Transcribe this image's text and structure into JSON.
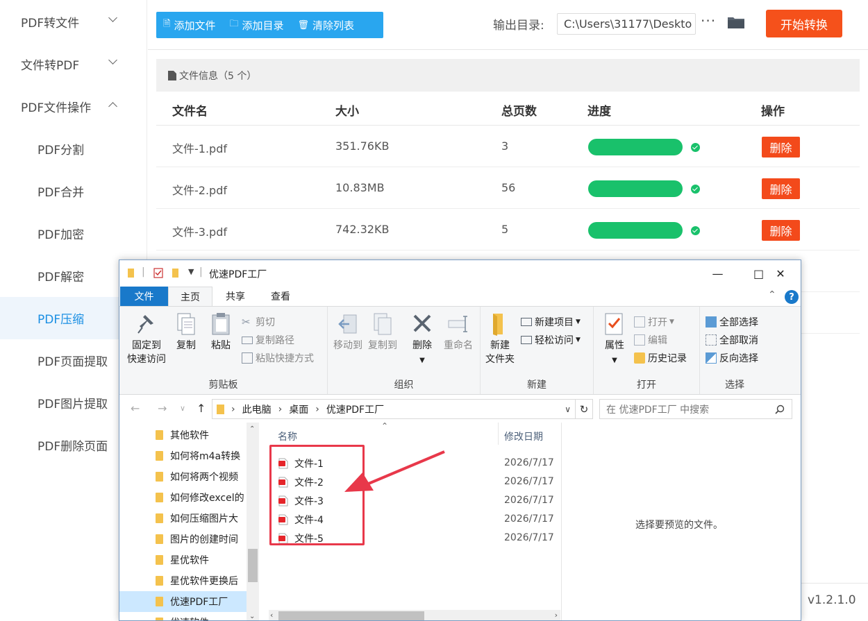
{
  "sidebar": {
    "items": [
      {
        "label": "PDF转文件",
        "chevron": "down"
      },
      {
        "label": "文件转PDF",
        "chevron": "down"
      },
      {
        "label": "PDF文件操作",
        "chevron": "up"
      },
      {
        "label": "PDF分割"
      },
      {
        "label": "PDF合并"
      },
      {
        "label": "PDF加密"
      },
      {
        "label": "PDF解密"
      },
      {
        "label": "PDF压缩",
        "active": true
      },
      {
        "label": "PDF页面提取"
      },
      {
        "label": "PDF图片提取"
      },
      {
        "label": "PDF删除页面"
      }
    ]
  },
  "toolbar": {
    "add_file": "添加文件",
    "add_dir": "添加目录",
    "clear_list": "清除列表",
    "output_label": "输出目录:",
    "output_path": "C:\\Users\\31177\\Deskto",
    "more": "···",
    "start": "开始转换"
  },
  "fileinfo": {
    "label": "文件信息（5 个）"
  },
  "table": {
    "headers": {
      "name": "文件名",
      "size": "大小",
      "pages": "总页数",
      "progress": "进度",
      "action": "操作"
    },
    "rows": [
      {
        "name": "文件-1.pdf",
        "size": "351.76KB",
        "pages": "3",
        "progress": 1.0,
        "action": "删除"
      },
      {
        "name": "文件-2.pdf",
        "size": "10.83MB",
        "pages": "56",
        "progress": 1.0,
        "action": "删除"
      },
      {
        "name": "文件-3.pdf",
        "size": "742.32KB",
        "pages": "5",
        "progress": 1.0,
        "action": "删除"
      }
    ]
  },
  "version": "v1.2.1.0",
  "explorer": {
    "title": "优速PDF工厂",
    "tabs": {
      "file": "文件",
      "home": "主页",
      "share": "共享",
      "view": "查看"
    },
    "ribbon": {
      "pin": "固定到\n快速访问",
      "pin_l1": "固定到",
      "pin_l2": "快速访问",
      "copy": "复制",
      "paste": "粘贴",
      "cut": "剪切",
      "copy_path": "复制路径",
      "paste_shortcut": "粘贴快捷方式",
      "clipboard": "剪贴板",
      "move_to": "移动到",
      "copy_to": "复制到",
      "delete": "删除",
      "rename": "重命名",
      "organize": "组织",
      "new_folder_l1": "新建",
      "new_folder_l2": "文件夹",
      "new_item": "新建项目",
      "easy_access": "轻松访问",
      "new": "新建",
      "properties": "属性",
      "open": "打开",
      "edit": "编辑",
      "history": "历史记录",
      "open_group": "打开",
      "select_all": "全部选择",
      "select_none": "全部取消",
      "invert": "反向选择",
      "select_group": "选择"
    },
    "address": {
      "parts": [
        "此电脑",
        "桌面",
        "优速PDF工厂"
      ]
    },
    "search_placeholder": "在 优速PDF工厂 中搜索",
    "tree": [
      {
        "label": "其他软件"
      },
      {
        "label": "如何将m4a转换"
      },
      {
        "label": "如何将两个视频"
      },
      {
        "label": "如何修改excel的"
      },
      {
        "label": "如何压缩图片大"
      },
      {
        "label": "图片的创建时间"
      },
      {
        "label": "星优软件"
      },
      {
        "label": "星优软件更换后"
      },
      {
        "label": "优速PDF工厂",
        "selected": true
      },
      {
        "label": "优速软件"
      }
    ],
    "columns": {
      "name": "名称",
      "date": "修改日期"
    },
    "files": [
      {
        "name": "文件-1",
        "date": "2026/7/17"
      },
      {
        "name": "文件-2",
        "date": "2026/7/17"
      },
      {
        "name": "文件-3",
        "date": "2026/7/17"
      },
      {
        "name": "文件-4",
        "date": "2026/7/17"
      },
      {
        "name": "文件-5",
        "date": "2026/7/17"
      }
    ],
    "preview_text": "选择要预览的文件。"
  },
  "colors": {
    "accent": "#29a6ef",
    "start": "#f5511b",
    "progress": "#19c16b",
    "delete": "#f34a1b",
    "annotation": "#e8384a"
  }
}
